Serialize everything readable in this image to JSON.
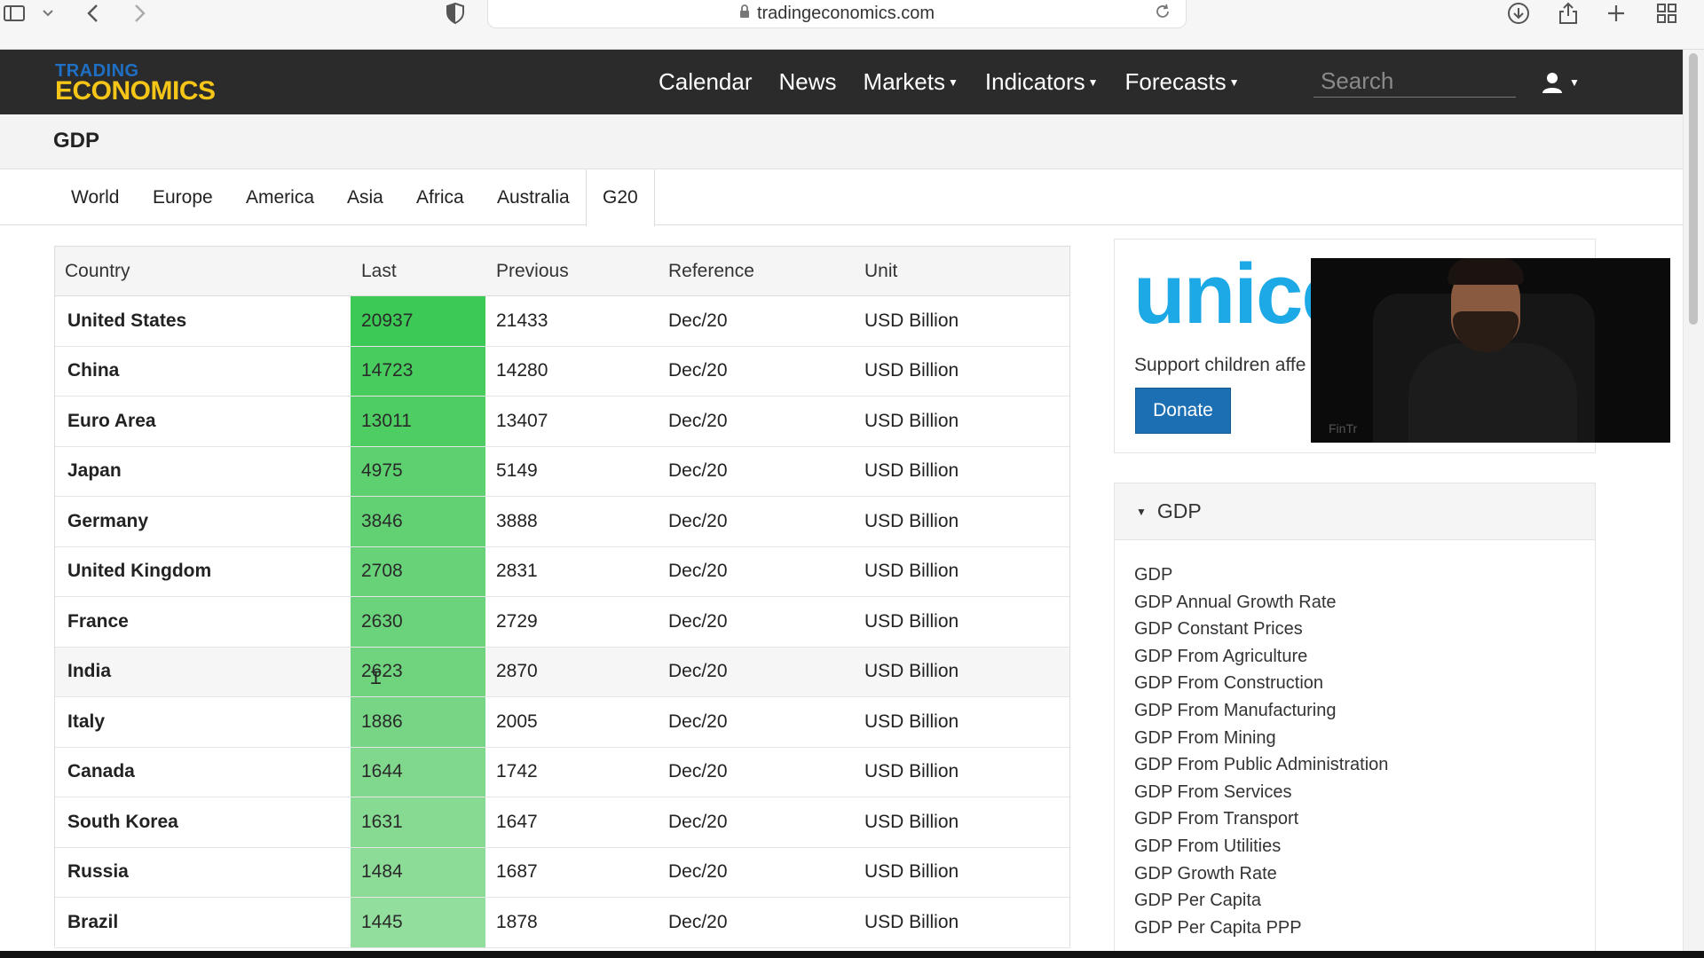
{
  "browser": {
    "url": "tradingeconomics.com"
  },
  "site": {
    "logo_top": "TRADING",
    "logo_bottom": "ECONOMICS",
    "nav": [
      {
        "label": "Calendar",
        "dropdown": false
      },
      {
        "label": "News",
        "dropdown": false
      },
      {
        "label": "Markets",
        "dropdown": true
      },
      {
        "label": "Indicators",
        "dropdown": true
      },
      {
        "label": "Forecasts",
        "dropdown": true
      }
    ],
    "search_placeholder": "Search"
  },
  "page": {
    "title": "GDP",
    "tabs": [
      "World",
      "Europe",
      "America",
      "Asia",
      "Africa",
      "Australia",
      "G20"
    ],
    "active_tab": "G20"
  },
  "table": {
    "headers": [
      "Country",
      "Last",
      "Previous",
      "Reference",
      "Unit"
    ],
    "rows": [
      {
        "country": "United States",
        "last": "20937",
        "previous": "21433",
        "reference": "Dec/20",
        "unit": "USD Billion",
        "color": "#3cc955"
      },
      {
        "country": "China",
        "last": "14723",
        "previous": "14280",
        "reference": "Dec/20",
        "unit": "USD Billion",
        "color": "#48cc5e"
      },
      {
        "country": "Euro Area",
        "last": "13011",
        "previous": "13407",
        "reference": "Dec/20",
        "unit": "USD Billion",
        "color": "#4ecd62"
      },
      {
        "country": "Japan",
        "last": "4975",
        "previous": "5149",
        "reference": "Dec/20",
        "unit": "USD Billion",
        "color": "#5dd06f"
      },
      {
        "country": "Germany",
        "last": "3846",
        "previous": "3888",
        "reference": "Dec/20",
        "unit": "USD Billion",
        "color": "#62d173"
      },
      {
        "country": "United Kingdom",
        "last": "2708",
        "previous": "2831",
        "reference": "Dec/20",
        "unit": "USD Billion",
        "color": "#67d278"
      },
      {
        "country": "France",
        "last": "2630",
        "previous": "2729",
        "reference": "Dec/20",
        "unit": "USD Billion",
        "color": "#6bd37b"
      },
      {
        "country": "India",
        "last": "2623",
        "previous": "2870",
        "reference": "Dec/20",
        "unit": "USD Billion",
        "color": "#70d47f"
      },
      {
        "country": "Italy",
        "last": "1886",
        "previous": "2005",
        "reference": "Dec/20",
        "unit": "USD Billion",
        "color": "#77d685"
      },
      {
        "country": "Canada",
        "last": "1644",
        "previous": "1742",
        "reference": "Dec/20",
        "unit": "USD Billion",
        "color": "#7fd88c"
      },
      {
        "country": "South Korea",
        "last": "1631",
        "previous": "1647",
        "reference": "Dec/20",
        "unit": "USD Billion",
        "color": "#86da92"
      },
      {
        "country": "Russia",
        "last": "1484",
        "previous": "1687",
        "reference": "Dec/20",
        "unit": "USD Billion",
        "color": "#8cdc97"
      },
      {
        "country": "Brazil",
        "last": "1445",
        "previous": "1878",
        "reference": "Dec/20",
        "unit": "USD Billion",
        "color": "#92de9c"
      }
    ]
  },
  "ad": {
    "brand": "unice",
    "tagline": "Support children affe",
    "button": "Donate"
  },
  "panel": {
    "title": "GDP",
    "links": [
      "GDP",
      "GDP Annual Growth Rate",
      "GDP Constant Prices",
      "GDP From Agriculture",
      "GDP From Construction",
      "GDP From Manufacturing",
      "GDP From Mining",
      "GDP From Public Administration",
      "GDP From Services",
      "GDP From Transport",
      "GDP From Utilities",
      "GDP Growth Rate",
      "GDP Per Capita",
      "GDP Per Capita PPP"
    ]
  },
  "webcam": {
    "watermark": "FinTr"
  }
}
